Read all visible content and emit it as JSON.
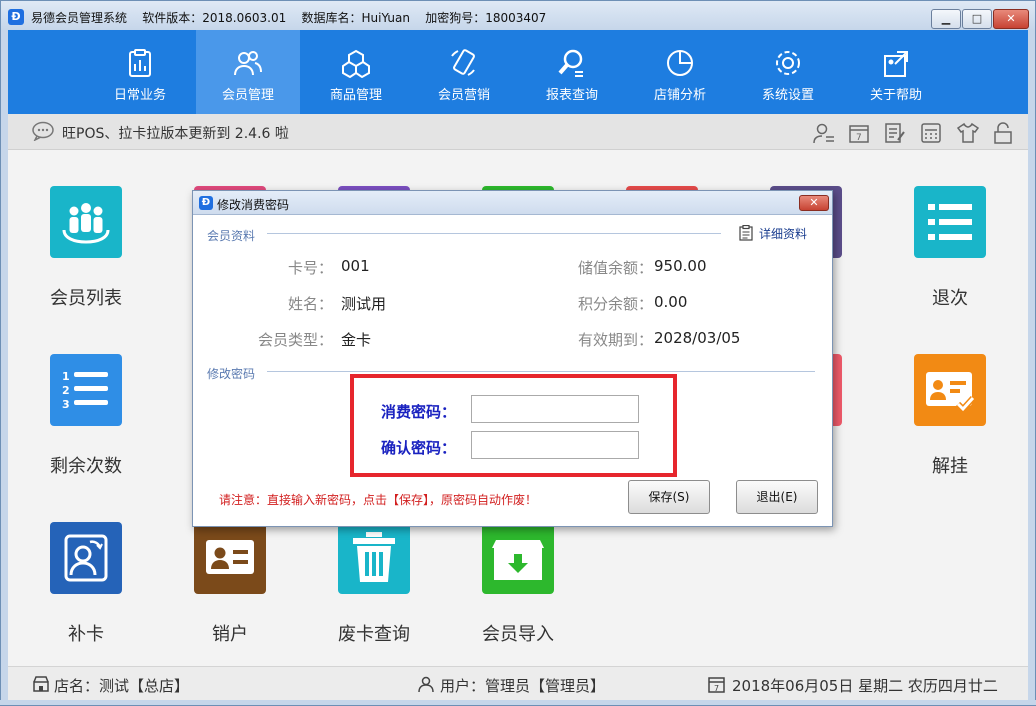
{
  "window": {
    "title": "易德会员管理系统    软件版本：2018.0603.01    数据库名：HuiYuan    加密狗号：18003407",
    "min_glyph": "▁",
    "max_glyph": "□",
    "close_glyph": "✕"
  },
  "nav": [
    {
      "label": "日常业务",
      "icon": "clipboard-chart-icon"
    },
    {
      "label": "会员管理",
      "icon": "users-icon",
      "active": true
    },
    {
      "label": "商品管理",
      "icon": "boxes-icon"
    },
    {
      "label": "会员营销",
      "icon": "mobile-icon"
    },
    {
      "label": "报表查询",
      "icon": "magnifier-icon"
    },
    {
      "label": "店铺分析",
      "icon": "pie-chart-icon"
    },
    {
      "label": "系统设置",
      "icon": "gear-icon"
    },
    {
      "label": "关于帮助",
      "icon": "help-icon"
    }
  ],
  "notice": {
    "text": "旺POS、拉卡拉版本更新到 2.4.6 啦"
  },
  "tiles": [
    {
      "label": "会员列表",
      "color": "#19b5c9"
    },
    {
      "label": "退次",
      "color": "#19b5c9"
    },
    {
      "label": "剩余次数",
      "color": "#2f8ee6"
    },
    {
      "label": "解挂",
      "color": "#f28a14"
    },
    {
      "label": "补卡",
      "color": "#2563b8"
    },
    {
      "label": "销户",
      "color": "#7b4a1a"
    },
    {
      "label": "废卡查询",
      "color": "#19b5c9"
    },
    {
      "label": "会员导入",
      "color": "#2db82d"
    }
  ],
  "status": {
    "store": "店名：测试【总店】",
    "user": "用户：管理员【管理员】",
    "date": "2018年06月05日 星期二 农历四月廿二"
  },
  "dialog": {
    "title": "修改消费密码",
    "close_glyph": "✕",
    "section_member": "会员资料",
    "detail_link": "详细资料",
    "fields": {
      "card_no_label": "卡号：",
      "card_no": "001",
      "name_label": "姓名：",
      "name": "测试用",
      "type_label": "会员类型：",
      "type": "金卡",
      "balance_label": "储值余额：",
      "balance": "950.00",
      "points_label": "积分余额：",
      "points": "0.00",
      "expiry_label": "有效期到：",
      "expiry": "2028/03/05"
    },
    "section_password": "修改密码",
    "password_label": "消费密码：",
    "confirm_label": "确认密码：",
    "password_value": "",
    "confirm_value": "",
    "note": "请注意：直接输入新密码，点击【保存】，原密码自动作废！",
    "save_label": "保存(S)",
    "exit_label": "退出(E)"
  }
}
